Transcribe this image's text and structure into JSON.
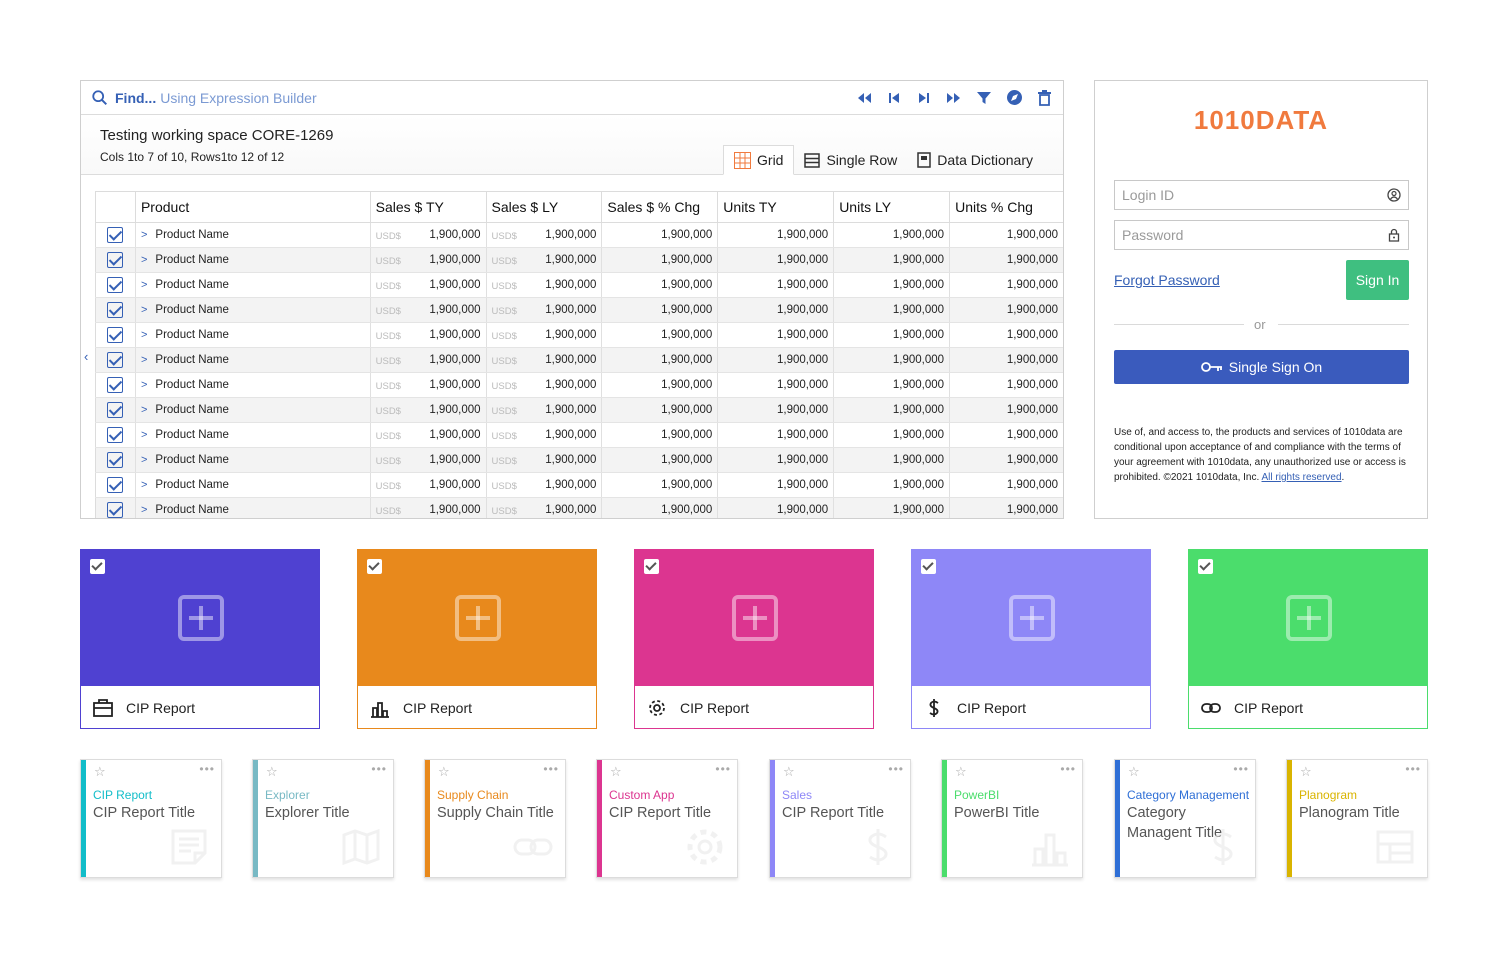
{
  "findbar": {
    "find_label": "Find...",
    "link_label": "Using Expression Builder"
  },
  "toolbar": {
    "icons": [
      "first-page-icon",
      "prev-page-icon",
      "next-page-icon",
      "last-page-icon",
      "filter-icon",
      "explore-icon",
      "trash-icon"
    ]
  },
  "workspace": {
    "title": "Testing working space CORE-1269",
    "subtitle": "Cols 1to 7 of 10, Rows1to 12 of 12"
  },
  "view_tabs": [
    {
      "label": "Grid",
      "icon": "grid-icon",
      "active": true
    },
    {
      "label": "Single Row",
      "icon": "single-row-icon",
      "active": false
    },
    {
      "label": "Data Dictionary",
      "icon": "book-icon",
      "active": false
    }
  ],
  "table": {
    "columns": [
      "Product",
      "Sales $ TY",
      "Sales $ LY",
      "Sales $ % Chg",
      "Units TY",
      "Units LY",
      "Units % Chg"
    ],
    "currency_label": "USD$",
    "rows": [
      {
        "product": "Product Name",
        "sales_ty": "1,900,000",
        "sales_ly": "1,900,000",
        "sales_chg": "1,900,000",
        "units_ty": "1,900,000",
        "units_ly": "1,900,000",
        "units_chg": "1,900,000"
      },
      {
        "product": "Product Name",
        "sales_ty": "1,900,000",
        "sales_ly": "1,900,000",
        "sales_chg": "1,900,000",
        "units_ty": "1,900,000",
        "units_ly": "1,900,000",
        "units_chg": "1,900,000"
      },
      {
        "product": "Product Name",
        "sales_ty": "1,900,000",
        "sales_ly": "1,900,000",
        "sales_chg": "1,900,000",
        "units_ty": "1,900,000",
        "units_ly": "1,900,000",
        "units_chg": "1,900,000"
      },
      {
        "product": "Product Name",
        "sales_ty": "1,900,000",
        "sales_ly": "1,900,000",
        "sales_chg": "1,900,000",
        "units_ty": "1,900,000",
        "units_ly": "1,900,000",
        "units_chg": "1,900,000"
      },
      {
        "product": "Product Name",
        "sales_ty": "1,900,000",
        "sales_ly": "1,900,000",
        "sales_chg": "1,900,000",
        "units_ty": "1,900,000",
        "units_ly": "1,900,000",
        "units_chg": "1,900,000"
      },
      {
        "product": "Product Name",
        "sales_ty": "1,900,000",
        "sales_ly": "1,900,000",
        "sales_chg": "1,900,000",
        "units_ty": "1,900,000",
        "units_ly": "1,900,000",
        "units_chg": "1,900,000"
      },
      {
        "product": "Product Name",
        "sales_ty": "1,900,000",
        "sales_ly": "1,900,000",
        "sales_chg": "1,900,000",
        "units_ty": "1,900,000",
        "units_ly": "1,900,000",
        "units_chg": "1,900,000"
      },
      {
        "product": "Product Name",
        "sales_ty": "1,900,000",
        "sales_ly": "1,900,000",
        "sales_chg": "1,900,000",
        "units_ty": "1,900,000",
        "units_ly": "1,900,000",
        "units_chg": "1,900,000"
      },
      {
        "product": "Product Name",
        "sales_ty": "1,900,000",
        "sales_ly": "1,900,000",
        "sales_chg": "1,900,000",
        "units_ty": "1,900,000",
        "units_ly": "1,900,000",
        "units_chg": "1,900,000"
      },
      {
        "product": "Product Name",
        "sales_ty": "1,900,000",
        "sales_ly": "1,900,000",
        "sales_chg": "1,900,000",
        "units_ty": "1,900,000",
        "units_ly": "1,900,000",
        "units_chg": "1,900,000"
      },
      {
        "product": "Product Name",
        "sales_ty": "1,900,000",
        "sales_ly": "1,900,000",
        "sales_chg": "1,900,000",
        "units_ty": "1,900,000",
        "units_ly": "1,900,000",
        "units_chg": "1,900,000"
      },
      {
        "product": "Product Name",
        "sales_ty": "1,900,000",
        "sales_ly": "1,900,000",
        "sales_chg": "1,900,000",
        "units_ty": "1,900,000",
        "units_ly": "1,900,000",
        "units_chg": "1,900,000"
      }
    ]
  },
  "login": {
    "logo": "1010DATA",
    "login_placeholder": "Login ID",
    "password_placeholder": "Password",
    "forgot_label": "Forgot Password",
    "signin_label": "Sign In",
    "or_label": "or",
    "sso_label": "Single Sign On",
    "legal_text": "Use of, and access to, the products and services of 1010data are conditional upon acceptance of and compliance with the terms of your agreement with 1010data, any unauthorized use or access is prohibited. ©2021 1010data, Inc.",
    "legal_link": "All rights reserved",
    "legal_end": ".",
    "colors": {
      "logo": "#f07a3e",
      "signin": "#3fbf80",
      "sso": "#3a5bbd"
    }
  },
  "tiles": [
    {
      "label": "CIP Report",
      "icon": "briefcase-icon",
      "color": "#4f41d1"
    },
    {
      "label": "CIP Report",
      "icon": "bar-chart-icon",
      "color": "#e8891c"
    },
    {
      "label": "CIP Report",
      "icon": "gear-icon",
      "color": "#dc3590"
    },
    {
      "label": "CIP Report",
      "icon": "dollar-icon",
      "color": "#8e87f7"
    },
    {
      "label": "CIP Report",
      "icon": "link-icon",
      "color": "#4bdd6c"
    }
  ],
  "cards": [
    {
      "category": "CIP Report",
      "title": "CIP Report Title",
      "color": "#12bdc9",
      "icon": "document-icon"
    },
    {
      "category": "Explorer",
      "title": "Explorer Title",
      "color": "#78b9c4",
      "icon": "map-icon"
    },
    {
      "category": "Supply Chain",
      "title": "Supply Chain Title",
      "color": "#e8891c",
      "icon": "link-icon"
    },
    {
      "category": "Custom App",
      "title": "CIP Report Title",
      "color": "#dc3590",
      "icon": "gear-icon"
    },
    {
      "category": "Sales",
      "title": "CIP Report Title",
      "color": "#8e87f7",
      "icon": "dollar-icon"
    },
    {
      "category": "PowerBI",
      "title": "PowerBI Title",
      "color": "#4bdd6c",
      "icon": "bar-chart-icon"
    },
    {
      "category": "Category Management",
      "title": "Category Managent Title",
      "color": "#2f6fd6",
      "icon": "dollar-icon"
    },
    {
      "category": "Planogram",
      "title": "Planogram Title",
      "color": "#d9b400",
      "icon": "layout-icon"
    }
  ]
}
